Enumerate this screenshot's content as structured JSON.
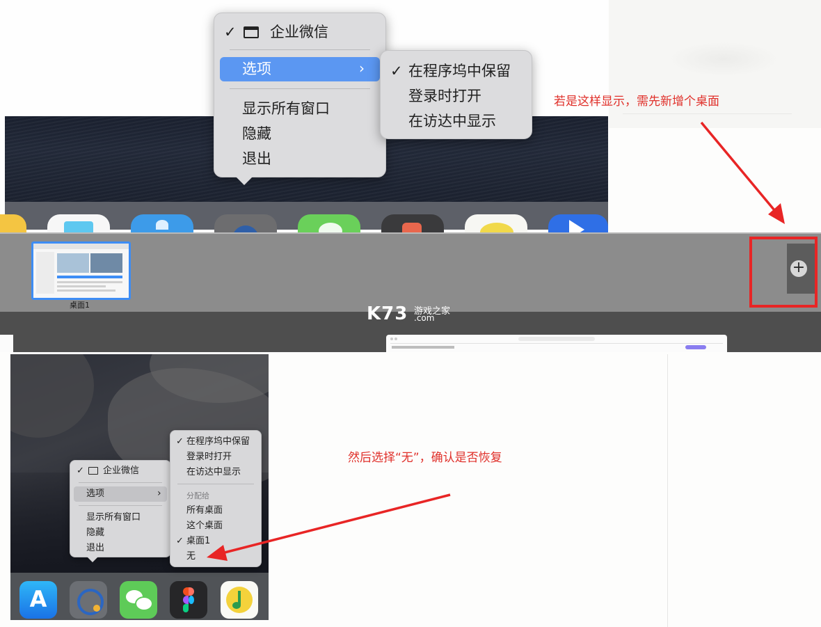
{
  "watermark": {
    "brand": "K73",
    "tagline": "游戏之家",
    "domain": ".com"
  },
  "top_menu": {
    "app_name": "企业微信",
    "options_label": "选项",
    "items": [
      "显示所有窗口",
      "隐藏",
      "退出"
    ],
    "submenu": [
      "在程序坞中保留",
      "登录时打开",
      "在访达中显示"
    ],
    "submenu_checked": "在程序坞中保留"
  },
  "annotation_1": "若是这样显示，需先新增个桌面",
  "mission_control": {
    "desktop_label": "桌面1",
    "add_symbol": "+"
  },
  "bottom_menu": {
    "app_name": "企业微信",
    "options_label": "选项",
    "items": [
      "显示所有窗口",
      "隐藏",
      "退出"
    ],
    "submenu": [
      "在程序坞中保留",
      "登录时打开",
      "在访达中显示"
    ],
    "assign_header": "分配给",
    "assign_items": [
      "所有桌面",
      "这个桌面",
      "桌面1",
      "无"
    ],
    "assign_checked": "桌面1"
  },
  "annotation_2": "然后选择“无”，确认是否恢复",
  "dock_apps": [
    "app-store-icon",
    "wecom-icon",
    "wechat-icon",
    "figma-icon",
    "qq-music-icon"
  ],
  "colors": {
    "menu_highlight": "#5b97f2",
    "annotation_red": "#e0302a",
    "selection_blue": "#3d8df5"
  }
}
